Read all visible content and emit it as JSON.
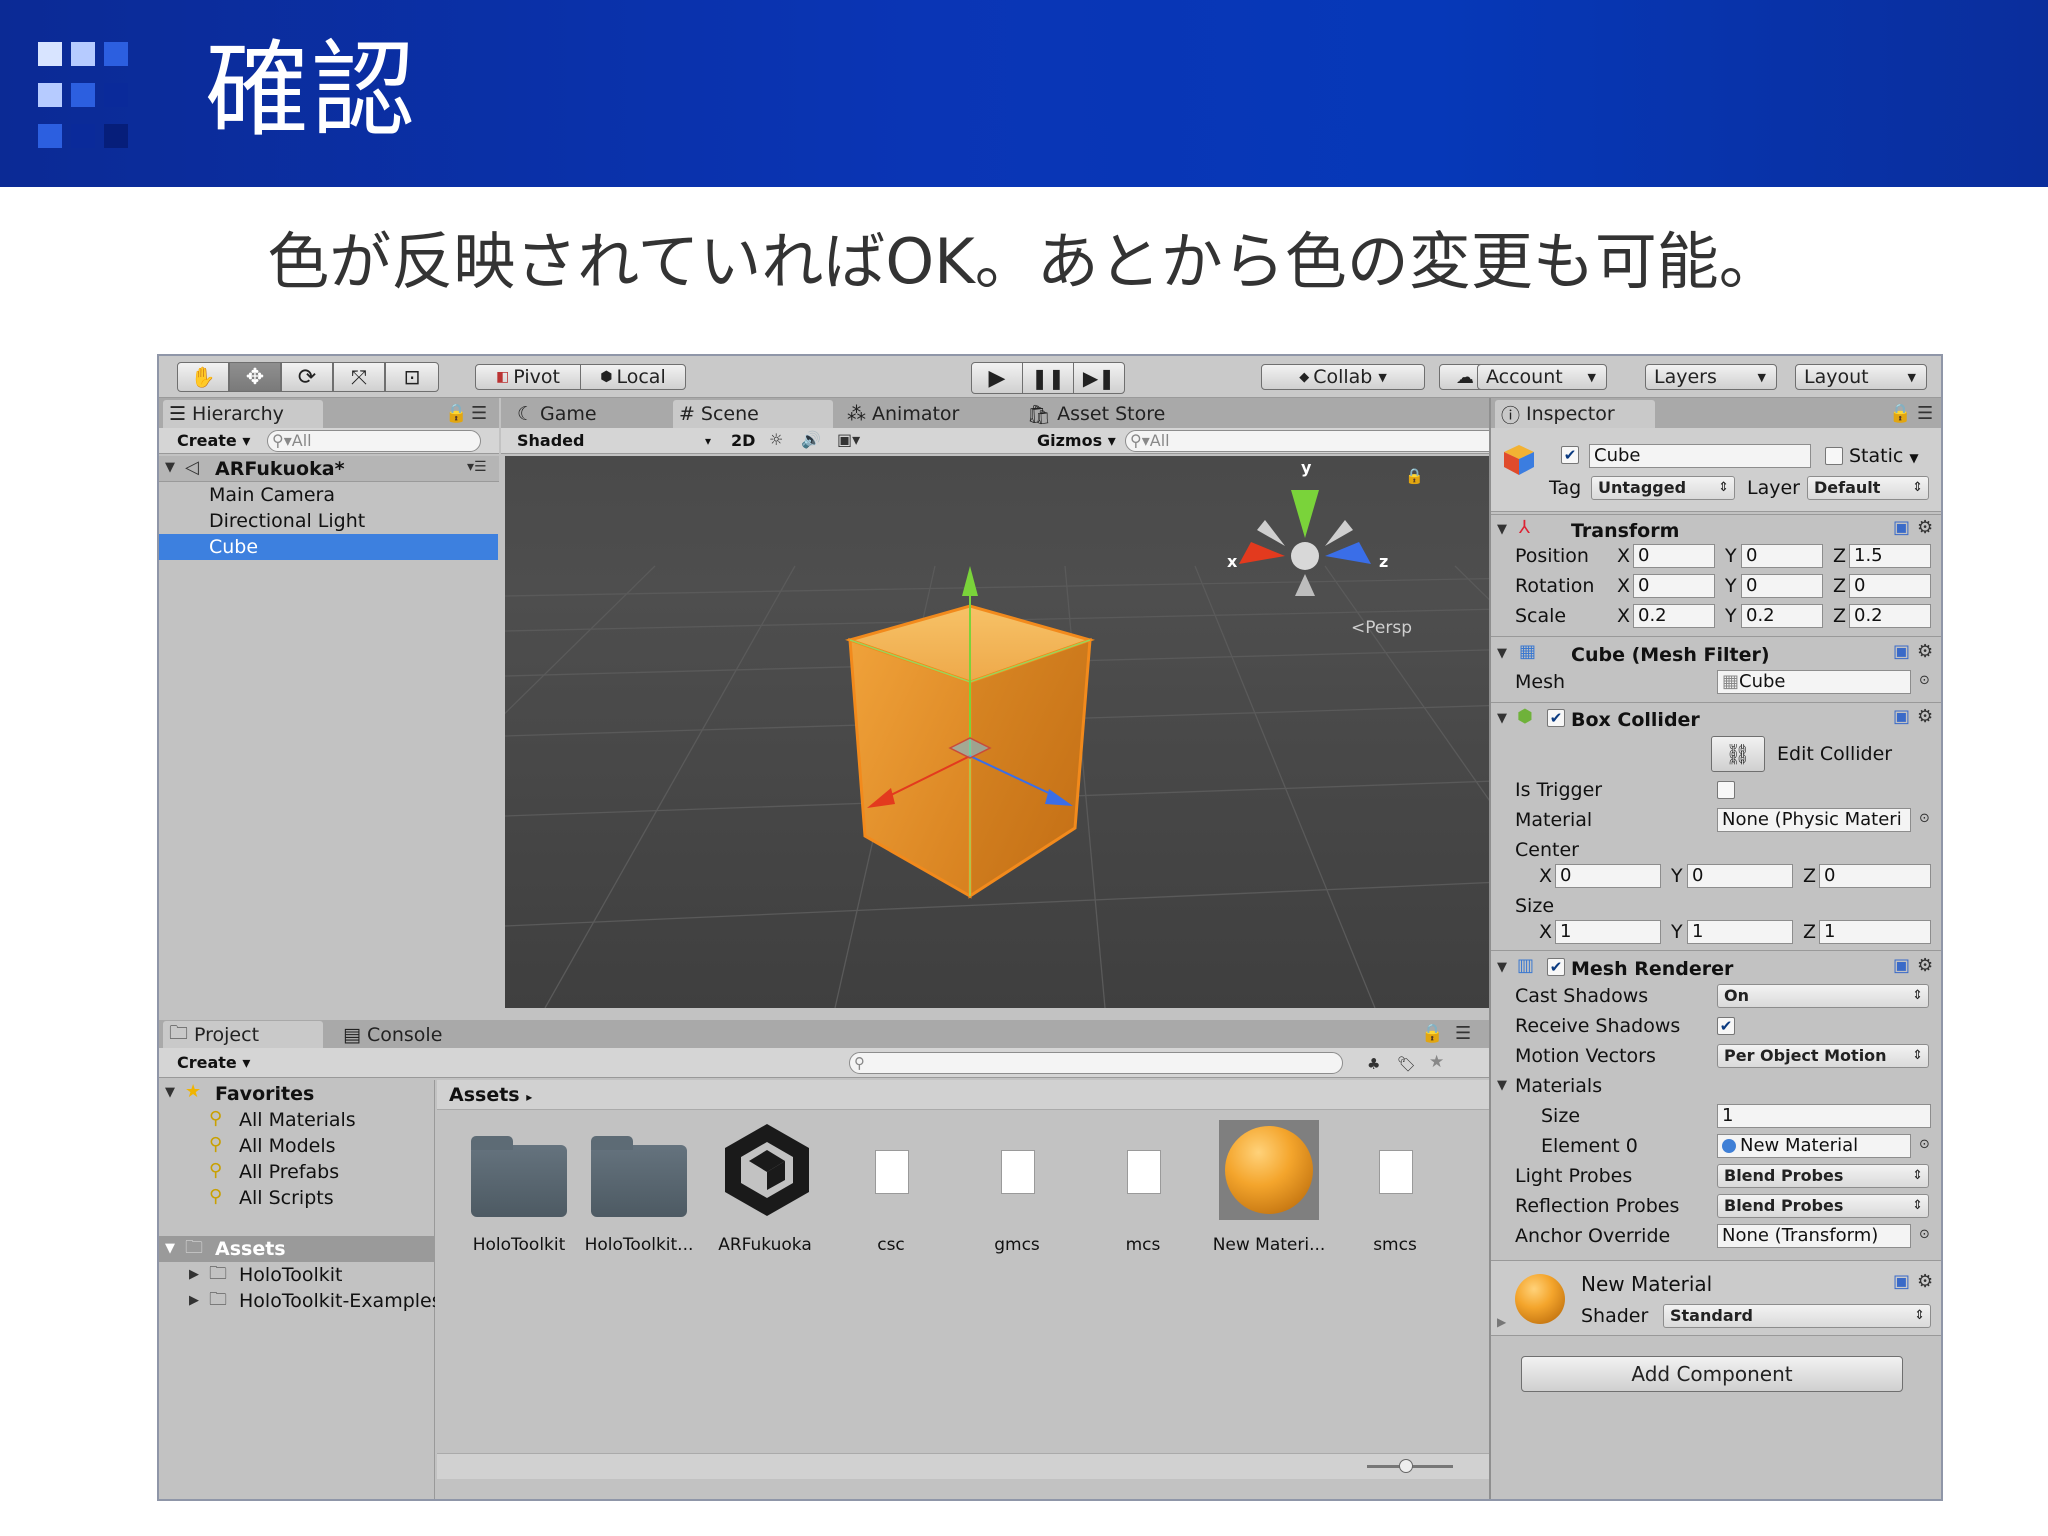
{
  "slide": {
    "title": "確認",
    "subtitle": "色が反映されていればOK。あとから色の変更も可能。",
    "header_color": "#0a35b5"
  },
  "toolbar": {
    "pivot": "Pivot",
    "local": "Local",
    "collab": "Collab",
    "account": "Account",
    "layers": "Layers",
    "layout": "Layout",
    "tools": [
      "hand-tool",
      "move-tool",
      "rotate-tool",
      "scale-tool",
      "rect-tool"
    ],
    "play_controls": [
      "play",
      "pause",
      "step"
    ]
  },
  "hierarchy": {
    "tab": "Hierarchy",
    "create": "Create",
    "search_placeholder": "All",
    "scene": "ARFukuoka*",
    "items": [
      "Main Camera",
      "Directional Light",
      "Cube"
    ],
    "selected": "Cube"
  },
  "scene_view": {
    "tabs": [
      "Game",
      "Scene",
      "Animator",
      "Asset Store"
    ],
    "active_tab": "Scene",
    "shading": "Shaded",
    "mode_2d": "2D",
    "gizmos": "Gizmos",
    "search_placeholder": "All",
    "persp": "Persp",
    "axes": {
      "x": "x",
      "y": "y",
      "z": "z"
    },
    "cube_color": "#f5a332"
  },
  "project": {
    "tab": "Project",
    "console_tab": "Console",
    "create": "Create",
    "favorites": "Favorites",
    "favorite_items": [
      "All Materials",
      "All Models",
      "All Prefabs",
      "All Scripts"
    ],
    "assets_root": "Assets",
    "asset_folders": [
      "HoloToolkit",
      "HoloToolkit-Examples"
    ],
    "breadcrumb": "Assets",
    "asset_items": [
      {
        "name": "HoloToolkit",
        "kind": "folder"
      },
      {
        "name": "HoloToolkit...",
        "kind": "folder"
      },
      {
        "name": "ARFukuoka",
        "kind": "unity-scene"
      },
      {
        "name": "csc",
        "kind": "file"
      },
      {
        "name": "gmcs",
        "kind": "file"
      },
      {
        "name": "mcs",
        "kind": "file"
      },
      {
        "name": "New Materi...",
        "kind": "material"
      },
      {
        "name": "smcs",
        "kind": "file"
      }
    ]
  },
  "inspector": {
    "tab": "Inspector",
    "object_name": "Cube",
    "static_label": "Static",
    "tag_label": "Tag",
    "tag_value": "Untagged",
    "layer_label": "Layer",
    "layer_value": "Default",
    "transform": {
      "title": "Transform",
      "position_label": "Position",
      "rotation_label": "Rotation",
      "scale_label": "Scale",
      "position": {
        "x": "0",
        "y": "0",
        "z": "1.5"
      },
      "rotation": {
        "x": "0",
        "y": "0",
        "z": "0"
      },
      "scale": {
        "x": "0.2",
        "y": "0.2",
        "z": "0.2"
      }
    },
    "mesh_filter": {
      "title": "Cube (Mesh Filter)",
      "mesh_label": "Mesh",
      "mesh_value": "Cube"
    },
    "box_collider": {
      "title": "Box Collider",
      "edit_collider": "Edit Collider",
      "is_trigger_label": "Is Trigger",
      "material_label": "Material",
      "material_value": "None (Physic Materi",
      "center_label": "Center",
      "center": {
        "x": "0",
        "y": "0",
        "z": "0"
      },
      "size_label": "Size",
      "size": {
        "x": "1",
        "y": "1",
        "z": "1"
      }
    },
    "mesh_renderer": {
      "title": "Mesh Renderer",
      "cast_shadows_label": "Cast Shadows",
      "cast_shadows_value": "On",
      "receive_shadows_label": "Receive Shadows",
      "motion_vectors_label": "Motion Vectors",
      "motion_vectors_value": "Per Object Motion",
      "materials_label": "Materials",
      "size_label": "Size",
      "size_value": "1",
      "element0_label": "Element 0",
      "element0_value": "New Material",
      "light_probes_label": "Light Probes",
      "light_probes_value": "Blend Probes",
      "reflection_probes_label": "Reflection Probes",
      "reflection_probes_value": "Blend Probes",
      "anchor_override_label": "Anchor Override",
      "anchor_override_value": "None (Transform)"
    },
    "material": {
      "name": "New Material",
      "shader_label": "Shader",
      "shader_value": "Standard"
    },
    "add_component": "Add Component"
  }
}
